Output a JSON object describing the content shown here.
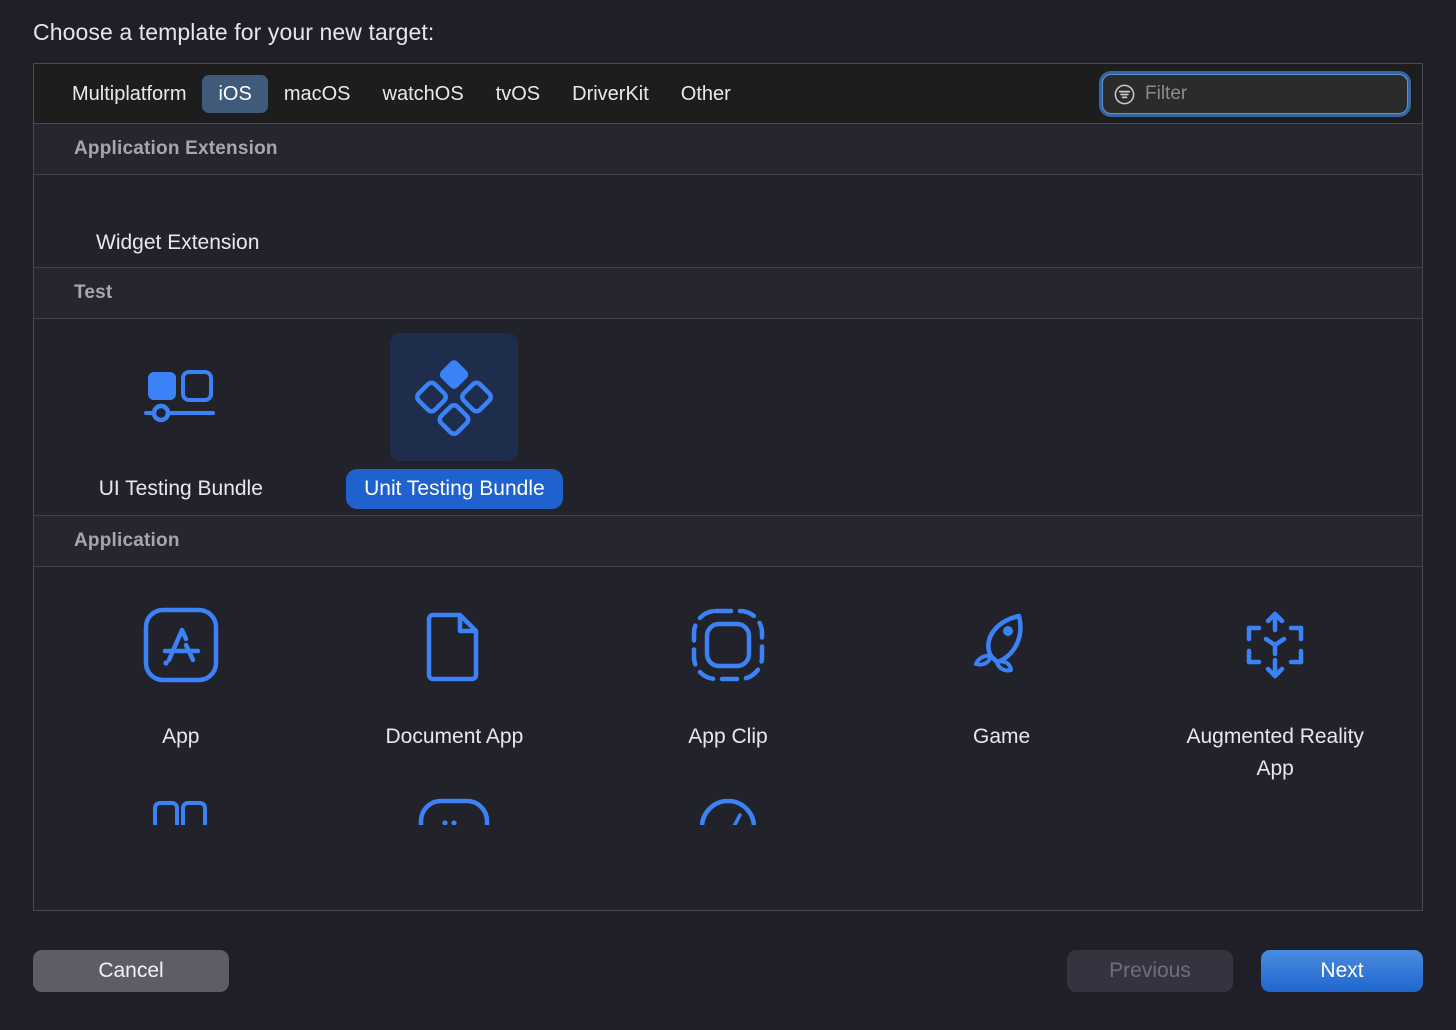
{
  "dialog": {
    "title": "Choose a template for your new target:"
  },
  "tabs": [
    {
      "label": "Multiplatform",
      "selected": false
    },
    {
      "label": "iOS",
      "selected": true
    },
    {
      "label": "macOS",
      "selected": false
    },
    {
      "label": "watchOS",
      "selected": false
    },
    {
      "label": "tvOS",
      "selected": false
    },
    {
      "label": "DriverKit",
      "selected": false
    },
    {
      "label": "Other",
      "selected": false
    }
  ],
  "search": {
    "placeholder": "Filter",
    "value": "",
    "icon": "filter-icon",
    "focused": true
  },
  "sections": [
    {
      "header": "Application Extension",
      "items": [
        {
          "label": "Widget Extension",
          "icon": "widget-extension-icon",
          "selected": false,
          "icon_clipped": true
        }
      ]
    },
    {
      "header": "Test",
      "items": [
        {
          "label": "UI Testing Bundle",
          "icon": "ui-testing-bundle-icon",
          "selected": false
        },
        {
          "label": "Unit Testing Bundle",
          "icon": "unit-testing-bundle-icon",
          "selected": true
        }
      ]
    },
    {
      "header": "Application",
      "items": [
        {
          "label": "App",
          "icon": "app-store-icon",
          "selected": false
        },
        {
          "label": "Document App",
          "icon": "document-icon",
          "selected": false
        },
        {
          "label": "App Clip",
          "icon": "app-clip-icon",
          "selected": false
        },
        {
          "label": "Game",
          "icon": "rocket-icon",
          "selected": false
        },
        {
          "label": "Augmented Reality App",
          "icon": "augmented-reality-icon",
          "selected": false
        }
      ]
    }
  ],
  "footer": {
    "cancel_label": "Cancel",
    "previous_label": "Previous",
    "next_label": "Next",
    "previous_disabled": true
  },
  "colors": {
    "accent_blue": "#1f66cd",
    "icon_blue": "#3b82f6",
    "selected_tab_bg": "#3f5b79",
    "panel_bg": "#22222b",
    "dialog_bg": "#1f1f27",
    "tabbar_bg": "#1d1d1d",
    "focus_ring": "#3e7fcb"
  }
}
